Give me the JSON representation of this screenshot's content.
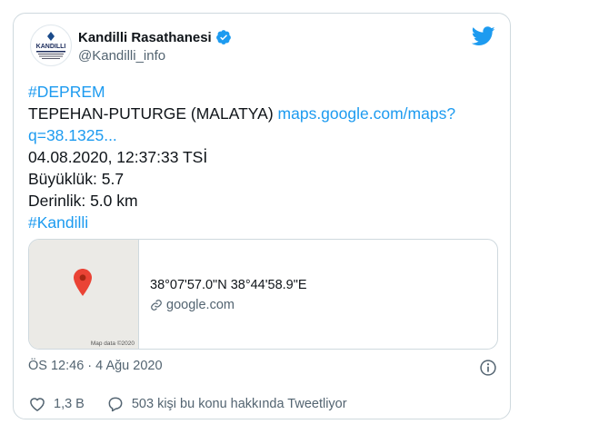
{
  "author": {
    "name": "Kandilli Rasathanesi",
    "handle": "@Kandilli_info",
    "avatar_text": "KANDILLI"
  },
  "tweet": {
    "hashtag_1": "#DEPREM",
    "location": "TEPEHAN-PUTURGE (MALATYA)",
    "map_link_line1": "maps.google.com/maps?",
    "map_link_line2": "q=38.1325...",
    "datetime": "04.08.2020, 12:37:33 TSİ",
    "magnitude": "Büyüklük: 5.7",
    "depth": "Derinlik: 5.0 km",
    "hashtag_2": "#Kandilli"
  },
  "map_card": {
    "coords": "38°07'57.0\"N 38°44'58.9\"E",
    "domain": "google.com",
    "credit": "Map data ©2020"
  },
  "timestamp": "ÖS 12:46 · 4 Ağu 2020",
  "actions": {
    "likes": "1,3 B",
    "replies": "503 kişi bu konu hakkında Tweetliyor"
  },
  "colors": {
    "link": "#1d9bf0",
    "muted": "#536471",
    "pin": "#ea4335",
    "verified": "#1d9bf0"
  },
  "icons": [
    "twitter-bird-icon",
    "verified-badge-icon",
    "map-pin-icon",
    "link-icon",
    "info-icon",
    "heart-icon",
    "reply-icon"
  ]
}
